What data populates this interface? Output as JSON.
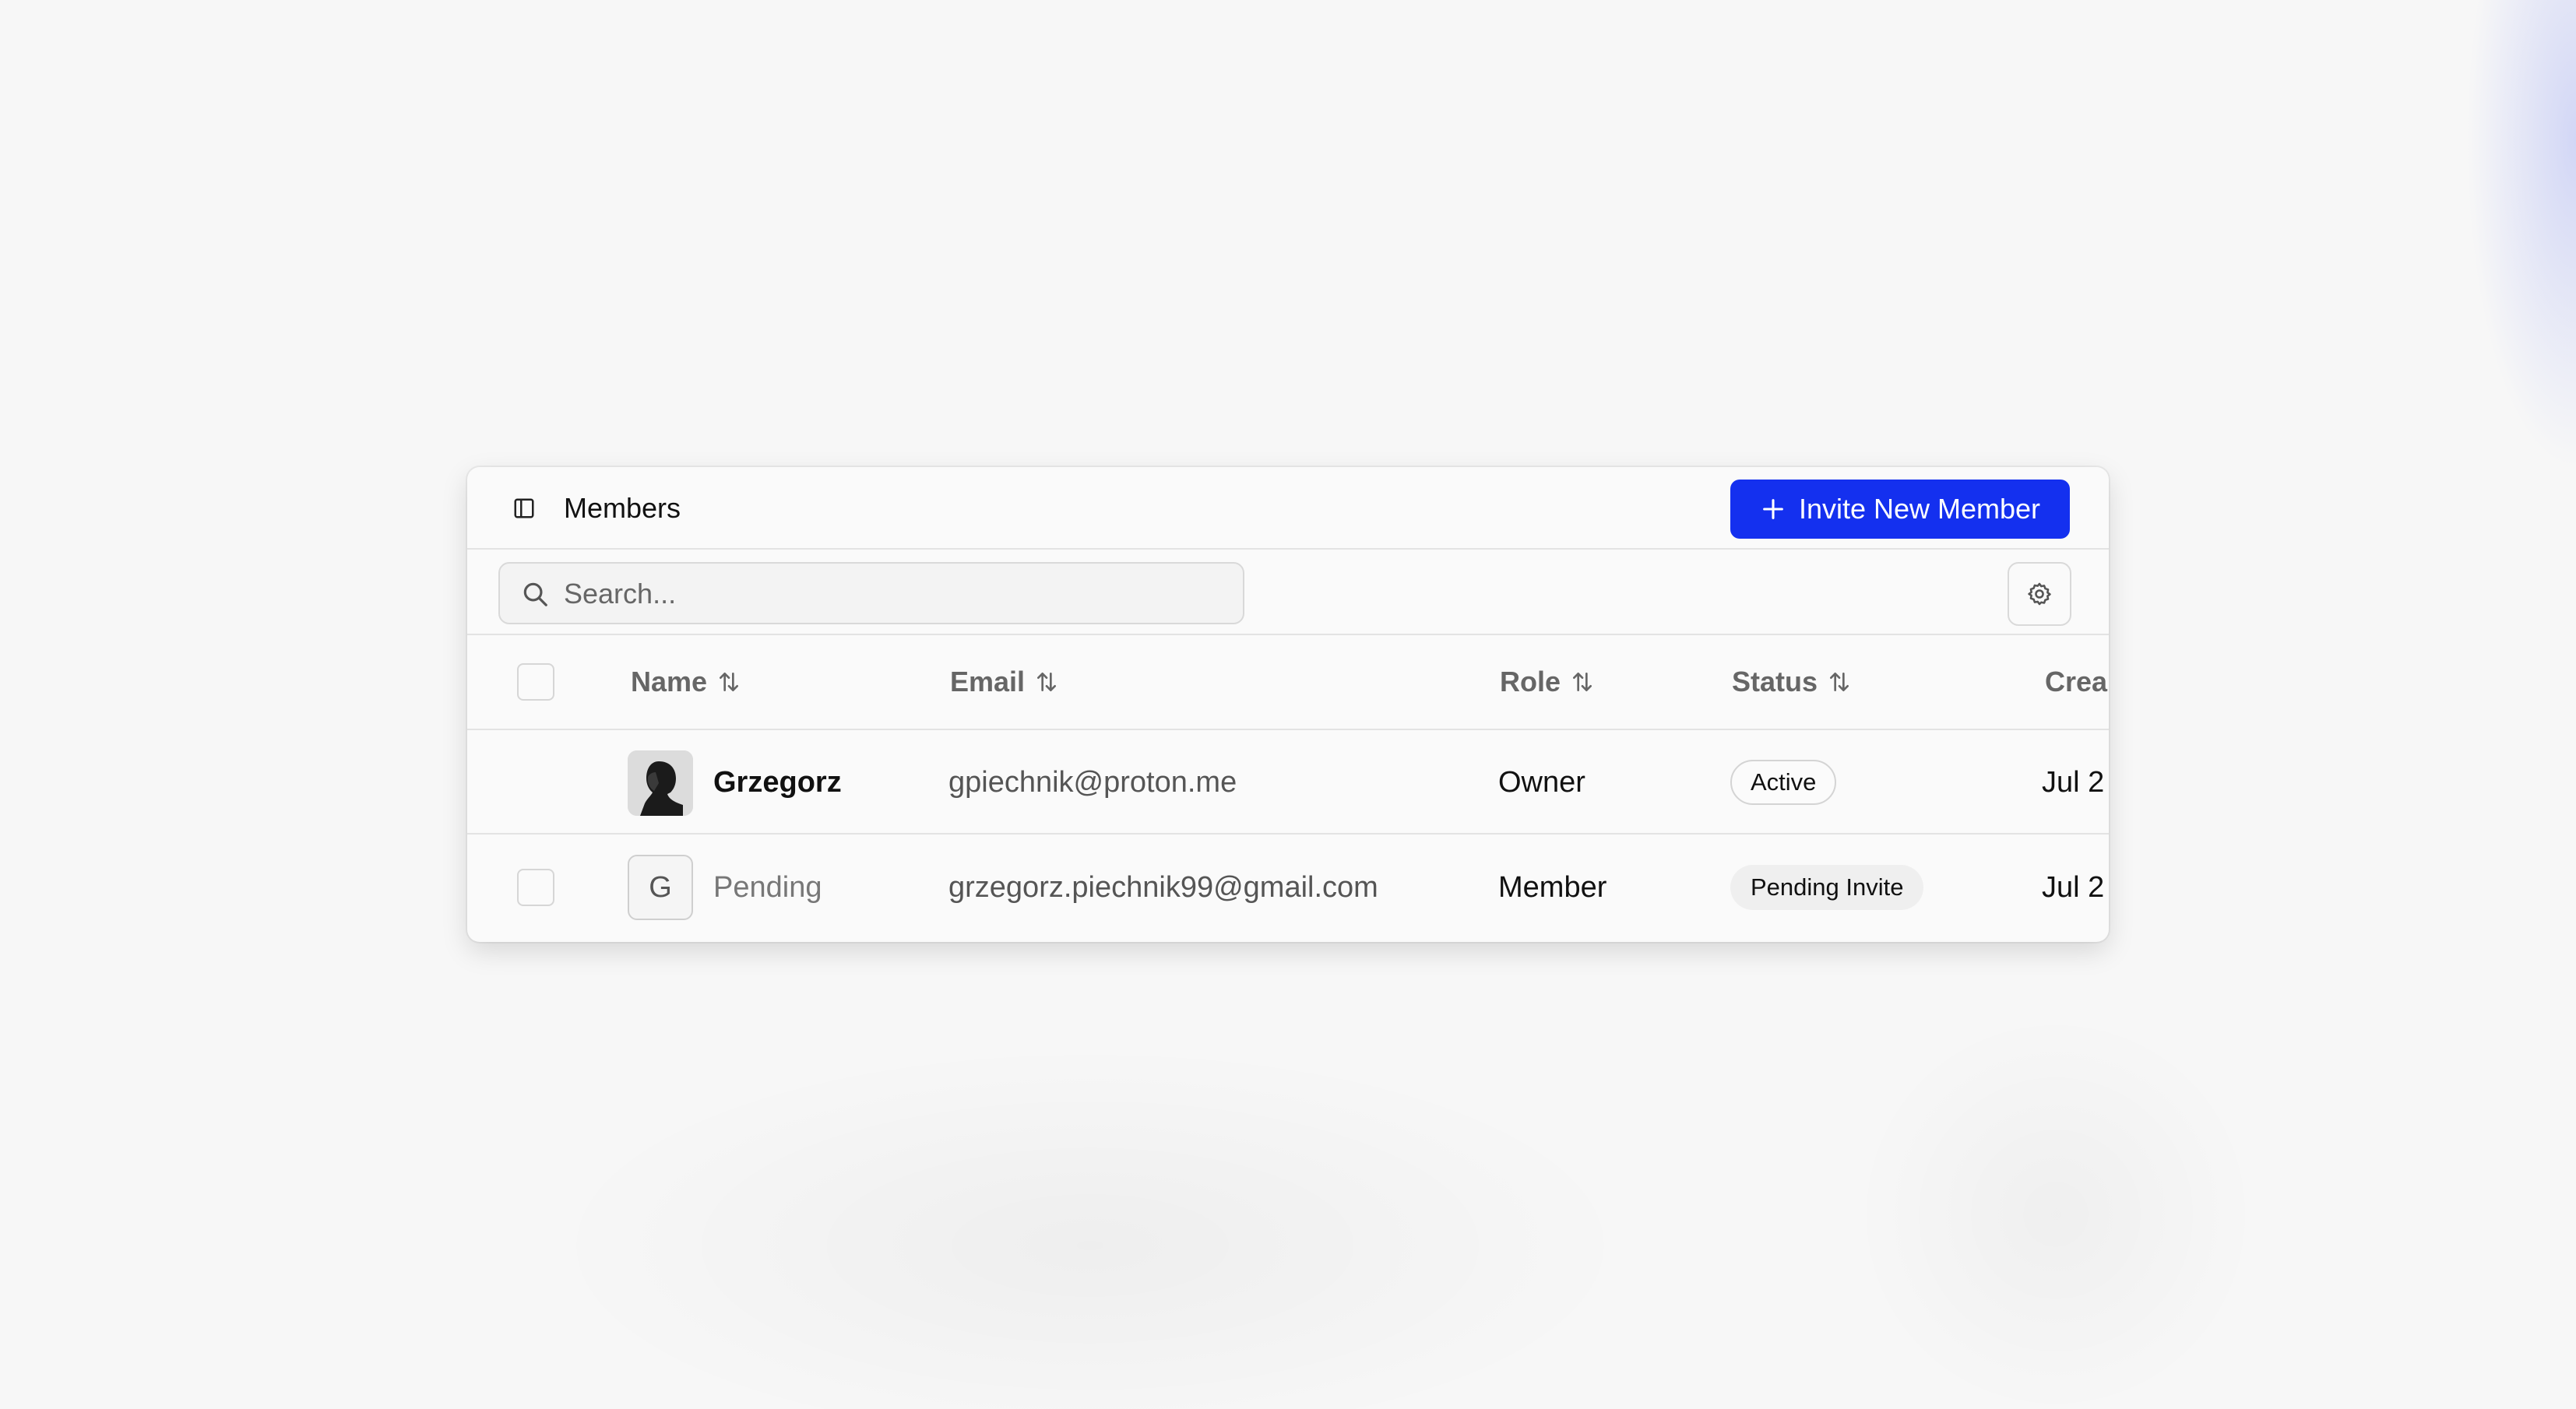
{
  "header": {
    "title": "Members",
    "invite_button_label": "Invite New Member",
    "accent_color": "#1430ef"
  },
  "toolbar": {
    "search_placeholder": "Search...",
    "search_value": ""
  },
  "table": {
    "columns": [
      {
        "label": "Name",
        "sortable": true
      },
      {
        "label": "Email",
        "sortable": true
      },
      {
        "label": "Role",
        "sortable": true
      },
      {
        "label": "Status",
        "sortable": true
      },
      {
        "label": "Crea",
        "sortable": false
      }
    ],
    "rows": [
      {
        "name": "Grzegorz",
        "avatar": "photo",
        "email": "gpiechnik@proton.me",
        "role": "Owner",
        "status": "Active",
        "created": "Jul 2",
        "selectable": false
      },
      {
        "name": "Pending",
        "avatar_initial": "G",
        "email": "grzegorz.piechnik99@gmail.com",
        "role": "Member",
        "status": "Pending Invite",
        "created": "Jul 2",
        "selectable": true
      }
    ]
  },
  "icons": {
    "sidebar_toggle": "panel-left-icon",
    "add": "plus-icon",
    "search": "search-icon",
    "settings": "gear-icon",
    "sort": "sort-arrows-icon"
  }
}
